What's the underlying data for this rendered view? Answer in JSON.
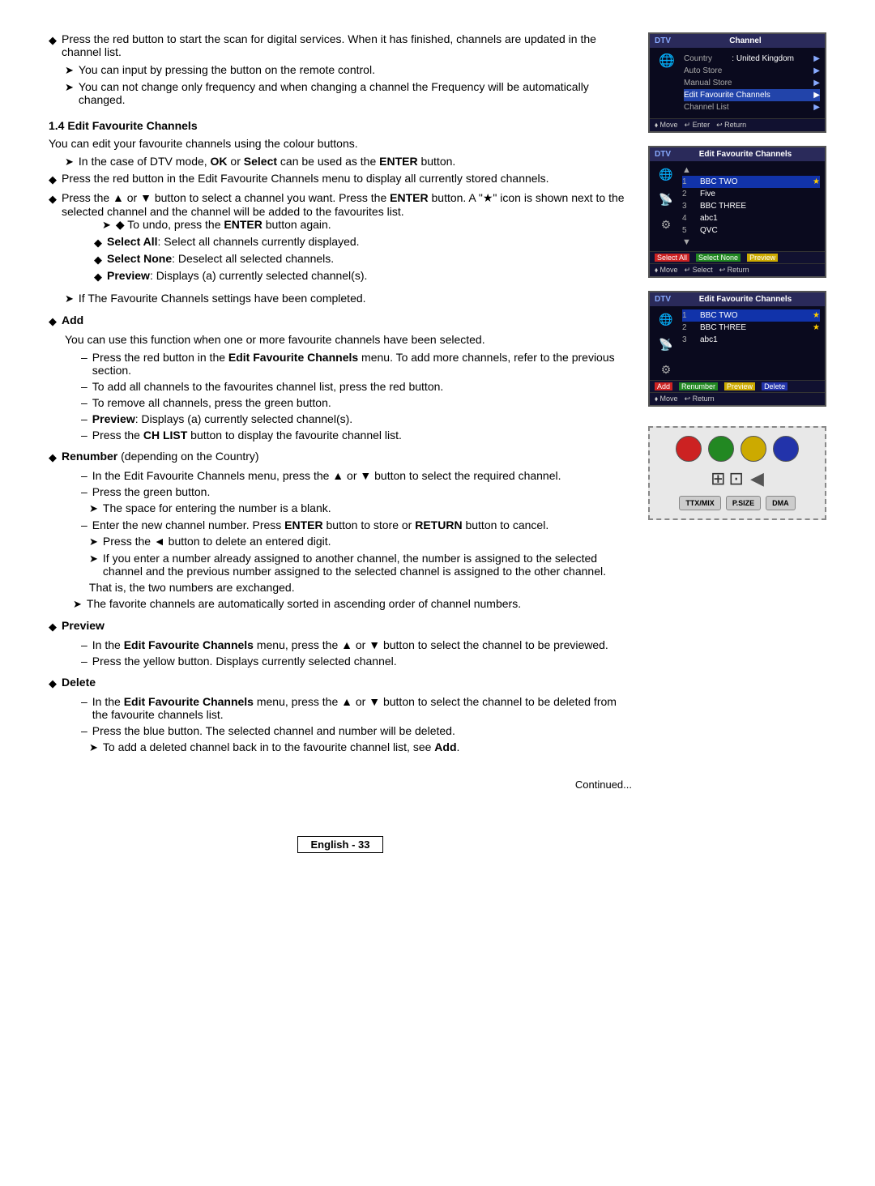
{
  "top_bullets": [
    {
      "type": "diamond",
      "text": "Press the red button to start the scan for digital services. When it has finished, channels are updated in the channel list."
    },
    {
      "type": "arrow",
      "text": "You can input by pressing the button on the remote control."
    },
    {
      "type": "arrow",
      "text": "You can not change only frequency and when changing a channel the Frequency will be automatically changed."
    }
  ],
  "section": {
    "number": "1.4",
    "title": "Edit Favourite Channels",
    "intro": "You can edit your favourite channels using the colour buttons."
  },
  "screen1": {
    "dtv": "DTV",
    "header": "Channel",
    "rows": [
      {
        "label": "Country",
        "value": ": United Kingdom",
        "arrow": "▶"
      },
      {
        "label": "Auto Store",
        "value": "",
        "arrow": "▶"
      },
      {
        "label": "Manual Store",
        "value": "",
        "arrow": "▶"
      },
      {
        "label": "Edit Favourite Channels",
        "value": "",
        "arrow": "▶",
        "highlighted": true
      },
      {
        "label": "Channel List",
        "value": "",
        "arrow": "▶"
      }
    ],
    "footer": [
      "⬧ Move",
      "↵ Enter",
      "↩ Return"
    ]
  },
  "screen2": {
    "dtv": "DTV",
    "header": "Edit Favourite Channels",
    "up_arrow": "▲",
    "channels": [
      {
        "num": "1",
        "name": "BBC TWO",
        "star": "★"
      },
      {
        "num": "2",
        "name": "Five",
        "star": ""
      },
      {
        "num": "3",
        "name": "BBC THREE",
        "star": ""
      },
      {
        "num": "4",
        "name": "abc1",
        "star": ""
      },
      {
        "num": "5",
        "name": "QVC",
        "star": ""
      }
    ],
    "down_arrow": "▼",
    "footer_items": [
      "Select All",
      "Select None",
      "Preview"
    ],
    "nav": [
      "⬧ Move",
      "↵ Select",
      "↩ Return"
    ]
  },
  "screen3": {
    "dtv": "DTV",
    "header": "Edit Favourite Channels",
    "channels": [
      {
        "num": "1",
        "name": "BBC TWO",
        "star": "★"
      },
      {
        "num": "2",
        "name": "BBC THREE",
        "star": "★"
      },
      {
        "num": "3",
        "name": "abc1",
        "star": ""
      }
    ],
    "footer_items": [
      "Add",
      "Renumber",
      "Preview",
      "Delete"
    ],
    "nav": [
      "⬧ Move",
      "↩ Return"
    ]
  },
  "remote": {
    "color_buttons": [
      "red",
      "green",
      "yellow",
      "blue"
    ],
    "icons": [
      "TTX/MIX",
      "P.SIZE",
      "DMA"
    ],
    "icon_symbols": [
      "⊞⊡",
      "▶|",
      "◀"
    ]
  },
  "main_content": {
    "intro_bullets": [
      {
        "type": "arrow",
        "indent": 1,
        "text": "In the case of DTV mode, OK or Select can be used as the ENTER button."
      }
    ],
    "bullets": [
      {
        "type": "diamond",
        "text": "Press the red button in the Edit Favourite Channels menu to display all currently stored channels."
      },
      {
        "type": "diamond",
        "text": "Press the ▲ or ▼ button to select a channel you want. Press the ENTER button. A \"★\" icon is shown next to the selected channel and the channel will be added to the favourites list.",
        "sub": [
          {
            "type": "arrow_diamond",
            "text": "To undo, press the ENTER button again."
          },
          {
            "type": "diamond",
            "text": "Select All: Select all channels currently displayed."
          },
          {
            "type": "diamond",
            "text": "Select None: Deselect all selected channels."
          },
          {
            "type": "diamond",
            "text": "Preview: Displays (a) currently selected channel(s)."
          }
        ]
      },
      {
        "type": "arrow",
        "text": "If The Favourite Channels settings have been completed."
      }
    ],
    "add_section": {
      "title": "Add",
      "intro": "You can use this function when one or more favourite channels have been selected.",
      "bullets": [
        "Press the red button in the Edit Favourite Channels menu. To add more channels, refer to the previous section.",
        "To add all channels to the favourites channel list, press the red button.",
        "To remove all channels, press the green button.",
        "Preview: Displays (a) currently selected channel(s).",
        "Press the CH LIST button to display the favourite channel list."
      ]
    },
    "renumber_section": {
      "title": "Renumber (depending on the Country)",
      "bullets": [
        "In the Edit Favourite Channels menu, press the ▲ or ▼ button to select the required channel.",
        "Press the green button.",
        [
          {
            "type": "arrow",
            "text": "The space for entering the number is a blank."
          }
        ],
        "Enter the new channel number. Press ENTER button to store or RETURN button to cancel.",
        [
          {
            "type": "arrow",
            "text": "Press the ◄ button to delete an entered digit."
          },
          {
            "type": "arrow",
            "text": "If you enter a number already assigned to another channel, the number is assigned to the selected channel and the previous number assigned to the selected channel is assigned to the other channel."
          }
        ],
        "That is, the two numbers are exchanged.",
        [
          {
            "type": "arrow",
            "text": "The favorite channels are automatically sorted in ascending order of channel numbers."
          }
        ]
      ]
    },
    "preview_section": {
      "title": "Preview",
      "bullets": [
        "In the Edit Favourite Channels menu, press the ▲ or ▼ button to select the channel to be previewed.",
        "Press the yellow button. Displays currently selected channel."
      ]
    },
    "delete_section": {
      "title": "Delete",
      "bullets": [
        "In the Edit Favourite Channels menu, press the ▲ or ▼ button to select the channel to be deleted from the favourite channels list.",
        "Press the blue button. The selected channel and number will be deleted.",
        [
          {
            "type": "arrow",
            "text": "To add a deleted channel back in to the favourite channel list, see Add."
          }
        ]
      ]
    }
  },
  "footer": {
    "continued": "Continued...",
    "english_label": "English - 33"
  }
}
